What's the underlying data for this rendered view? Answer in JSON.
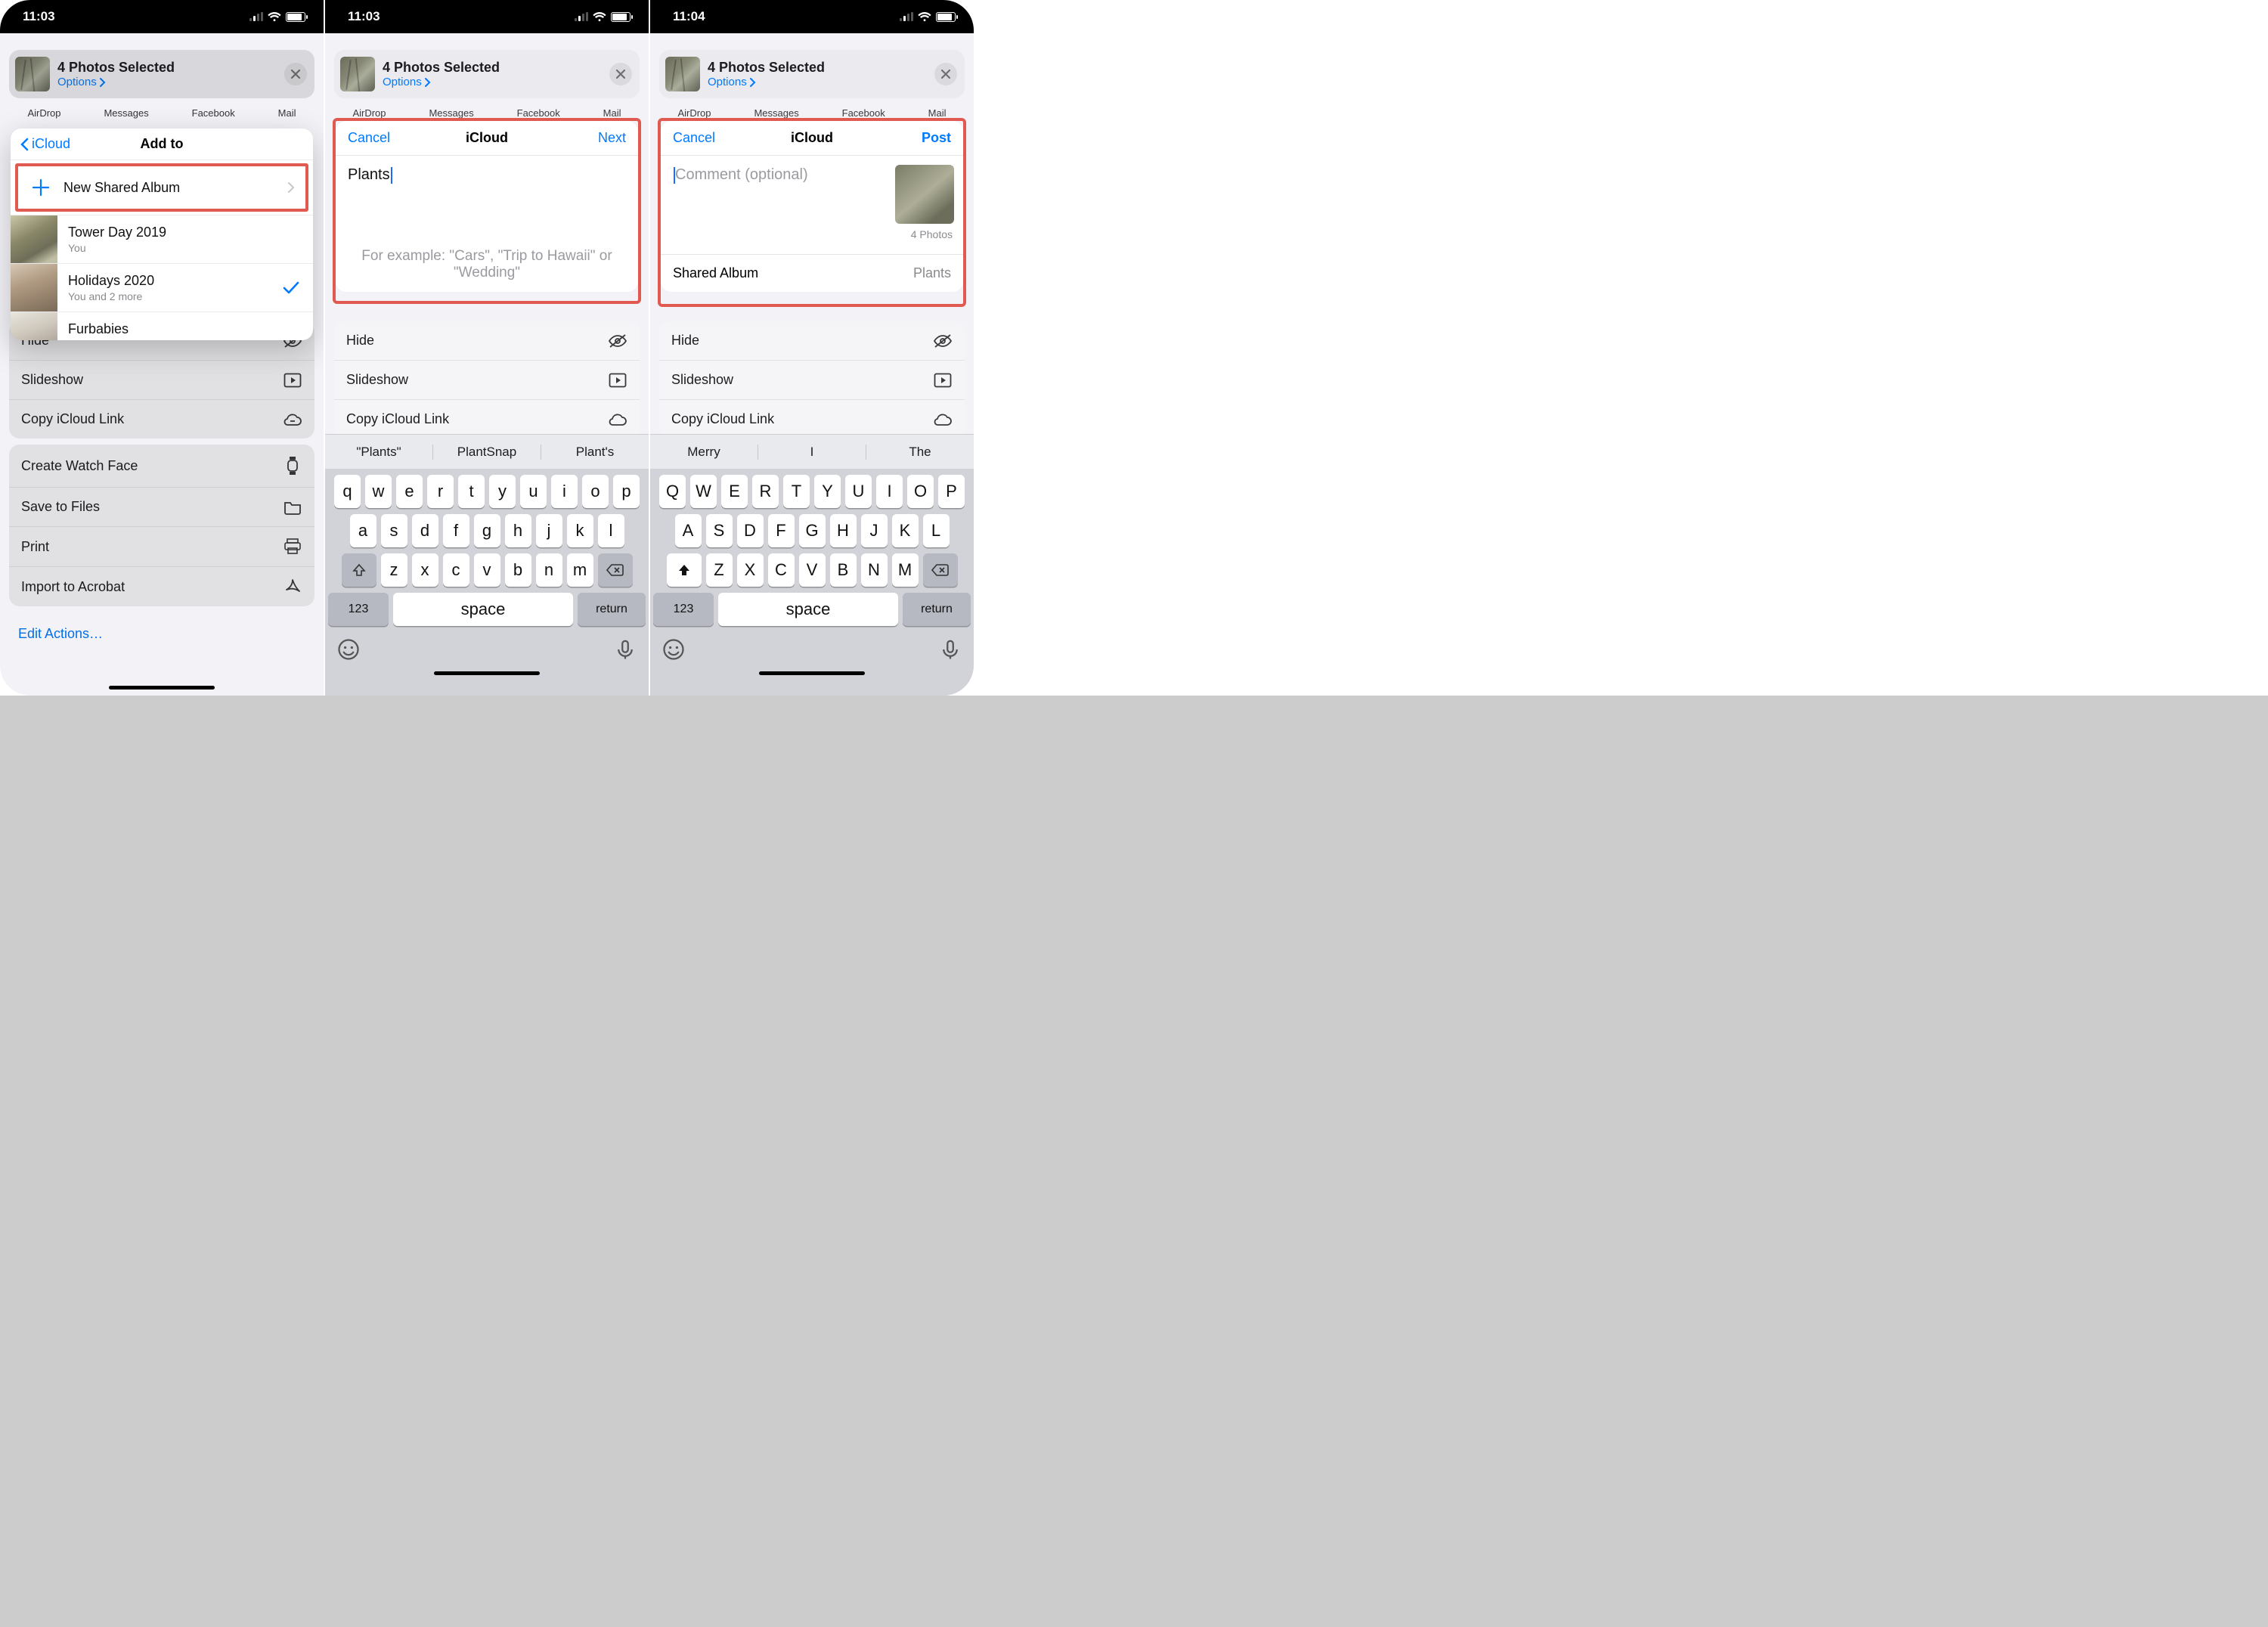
{
  "status": {
    "time1": "11:03",
    "time2": "11:03",
    "time3": "11:04"
  },
  "share": {
    "title": "4 Photos Selected",
    "options": "Options"
  },
  "apps": [
    "AirDrop",
    "Messages",
    "Facebook",
    "Mail"
  ],
  "actions1": {
    "hide": "Hide",
    "slideshow": "Slideshow",
    "copylink": "Copy iCloud Link",
    "watchface": "Create Watch Face",
    "savefiles": "Save to Files",
    "print": "Print",
    "acrobat": "Import to Acrobat",
    "edit": "Edit Actions…"
  },
  "sheet": {
    "back": "iCloud",
    "title": "Add to",
    "newAlbum": "New Shared Album",
    "albums": [
      {
        "name": "Tower Day 2019",
        "who": "You"
      },
      {
        "name": "Holidays 2020",
        "who": "You and 2 more",
        "checked": true
      },
      {
        "name": "Furbabies",
        "who": ""
      }
    ]
  },
  "card2": {
    "cancel": "Cancel",
    "title": "iCloud",
    "action": "Next",
    "value": "Plants",
    "hint": "For example: \"Cars\", \"Trip to Hawaii\" or \"Wedding\""
  },
  "card3": {
    "cancel": "Cancel",
    "title": "iCloud",
    "action": "Post",
    "placeholder": "Comment (optional)",
    "miniCount": "4 Photos",
    "footL": "Shared Album",
    "footR": "Plants"
  },
  "kbd2": {
    "sugg": [
      "\"Plants\"",
      "PlantSnap",
      "Plant's"
    ],
    "r1": [
      "q",
      "w",
      "e",
      "r",
      "t",
      "y",
      "u",
      "i",
      "o",
      "p"
    ],
    "r2": [
      "a",
      "s",
      "d",
      "f",
      "g",
      "h",
      "j",
      "k",
      "l"
    ],
    "r3": [
      "z",
      "x",
      "c",
      "v",
      "b",
      "n",
      "m"
    ],
    "n123": "123",
    "space": "space",
    "ret": "return"
  },
  "kbd3": {
    "sugg": [
      "Merry",
      "I",
      "The"
    ],
    "r1": [
      "Q",
      "W",
      "E",
      "R",
      "T",
      "Y",
      "U",
      "I",
      "O",
      "P"
    ],
    "r2": [
      "A",
      "S",
      "D",
      "F",
      "G",
      "H",
      "J",
      "K",
      "L"
    ],
    "r3": [
      "Z",
      "X",
      "C",
      "V",
      "B",
      "N",
      "M"
    ],
    "n123": "123",
    "space": "space",
    "ret": "return"
  },
  "actions23": {
    "hide": "Hide",
    "slideshow": "Slideshow",
    "copylink": "Copy iCloud Link",
    "copylink_cut": "Copy iCloud Link"
  }
}
